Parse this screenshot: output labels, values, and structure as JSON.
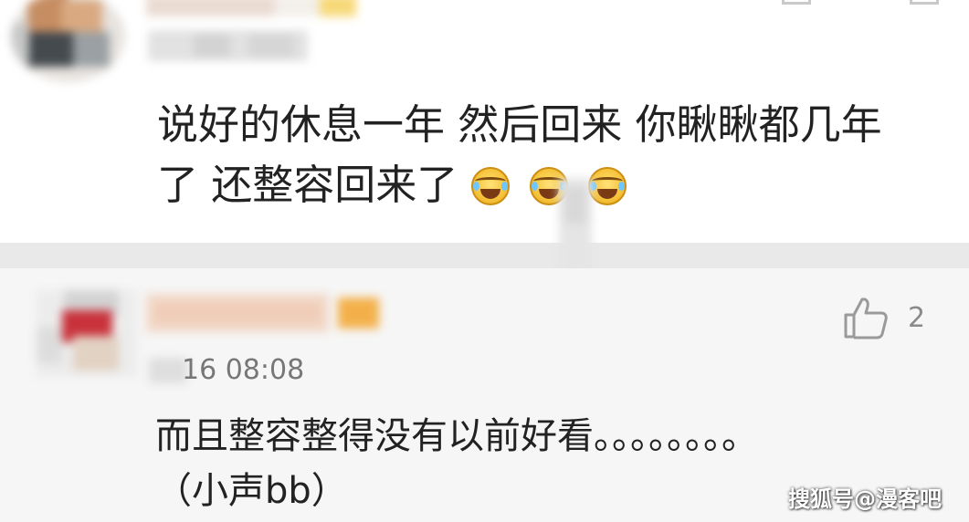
{
  "top_comment": {
    "text_line1": "说好的休息一年 然后回来 你瞅瞅都几年",
    "text_line2": "了 还整容回来了",
    "emojis": [
      "laugh-cry-emoji",
      "laugh-cry-emoji",
      "laugh-cry-emoji"
    ]
  },
  "bottom_comment": {
    "timestamp": "16 08:08",
    "like_count": "2",
    "text_line1": "而且整容整得没有以前好看。。。。。。。。",
    "text_line2": "（小声bb）"
  },
  "watermark": "搜狐号@漫客吧",
  "colors": {
    "page_bg": "#ffffff",
    "divider": "#e9e9e9",
    "reply_bg": "#f6f6f6",
    "text": "#222222",
    "meta_text": "#777777"
  },
  "icons": [
    "thumbs-up-icon"
  ]
}
